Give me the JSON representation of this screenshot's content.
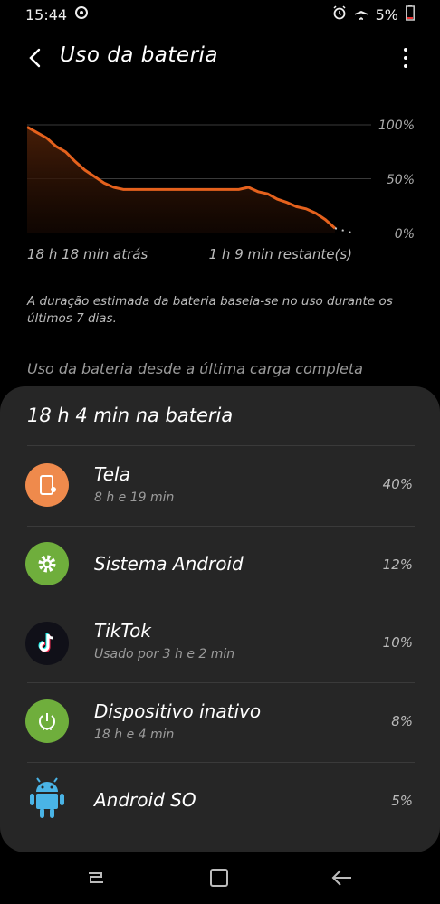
{
  "status": {
    "time": "15:44",
    "battery_text": "5%"
  },
  "appbar": {
    "title": "Uso da bateria"
  },
  "chart_data": {
    "type": "area",
    "title": "",
    "xlabel": "",
    "ylabel": "",
    "ylim": [
      0,
      100
    ],
    "ytick_labels": [
      "100%",
      "50%",
      "0%"
    ],
    "x_start_label": "18 h 18 min atrás",
    "x_end_label": "1 h 9 min restante(s)",
    "series": [
      {
        "values": [
          98,
          93,
          88,
          80,
          75,
          66,
          58,
          52,
          46,
          42,
          40,
          40,
          40,
          40,
          40,
          40,
          40,
          40,
          40,
          40,
          40,
          40,
          40,
          42,
          38,
          36,
          31,
          28,
          24,
          22,
          18,
          12,
          4
        ]
      }
    ],
    "projection": [
      4,
      0
    ],
    "colors": {
      "line": "#e4611d",
      "fill_top": "#4a1f08",
      "grid": "#3a3a3a"
    }
  },
  "description": "A duração estimada da bateria baseia-se no uso durante os últimos 7 dias.",
  "section_title": "Uso da bateria desde a última carga completa",
  "sheet": {
    "title": "18 h 4 min na bateria",
    "items": [
      {
        "name": "Tela",
        "sub": "8 h e 19 min",
        "pct": "40%",
        "icon": "screen-icon",
        "color": "#ef8a4c"
      },
      {
        "name": "Sistema Android",
        "sub": "",
        "pct": "12%",
        "icon": "gear-icon",
        "color": "#6fae3c"
      },
      {
        "name": "TikTok",
        "sub": "Usado por 3 h e 2 min",
        "pct": "10%",
        "icon": "tiktok-icon",
        "color": "#101018"
      },
      {
        "name": "Dispositivo inativo",
        "sub": "18 h e 4 min",
        "pct": "8%",
        "icon": "power-icon",
        "color": "#6fae3c"
      },
      {
        "name": "Android SO",
        "sub": "",
        "pct": "5%",
        "icon": "android-icon",
        "color": "#4ab4e6"
      }
    ]
  },
  "navbar": {
    "buttons": [
      "recent-apps-icon",
      "home-icon",
      "back-icon"
    ]
  }
}
